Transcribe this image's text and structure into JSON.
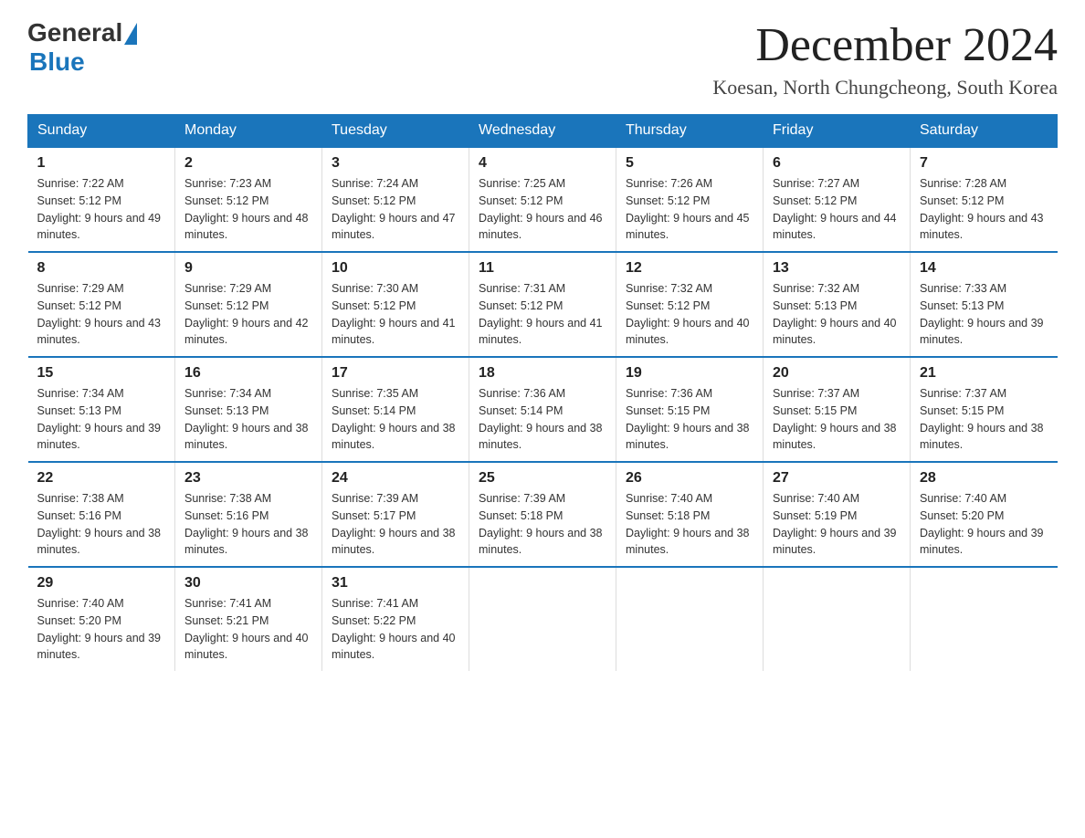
{
  "logo": {
    "general": "General",
    "blue": "Blue"
  },
  "title": "December 2024",
  "subtitle": "Koesan, North Chungcheong, South Korea",
  "days_of_week": [
    "Sunday",
    "Monday",
    "Tuesday",
    "Wednesday",
    "Thursday",
    "Friday",
    "Saturday"
  ],
  "weeks": [
    [
      {
        "day": "1",
        "sunrise": "7:22 AM",
        "sunset": "5:12 PM",
        "daylight": "9 hours and 49 minutes."
      },
      {
        "day": "2",
        "sunrise": "7:23 AM",
        "sunset": "5:12 PM",
        "daylight": "9 hours and 48 minutes."
      },
      {
        "day": "3",
        "sunrise": "7:24 AM",
        "sunset": "5:12 PM",
        "daylight": "9 hours and 47 minutes."
      },
      {
        "day": "4",
        "sunrise": "7:25 AM",
        "sunset": "5:12 PM",
        "daylight": "9 hours and 46 minutes."
      },
      {
        "day": "5",
        "sunrise": "7:26 AM",
        "sunset": "5:12 PM",
        "daylight": "9 hours and 45 minutes."
      },
      {
        "day": "6",
        "sunrise": "7:27 AM",
        "sunset": "5:12 PM",
        "daylight": "9 hours and 44 minutes."
      },
      {
        "day": "7",
        "sunrise": "7:28 AM",
        "sunset": "5:12 PM",
        "daylight": "9 hours and 43 minutes."
      }
    ],
    [
      {
        "day": "8",
        "sunrise": "7:29 AM",
        "sunset": "5:12 PM",
        "daylight": "9 hours and 43 minutes."
      },
      {
        "day": "9",
        "sunrise": "7:29 AM",
        "sunset": "5:12 PM",
        "daylight": "9 hours and 42 minutes."
      },
      {
        "day": "10",
        "sunrise": "7:30 AM",
        "sunset": "5:12 PM",
        "daylight": "9 hours and 41 minutes."
      },
      {
        "day": "11",
        "sunrise": "7:31 AM",
        "sunset": "5:12 PM",
        "daylight": "9 hours and 41 minutes."
      },
      {
        "day": "12",
        "sunrise": "7:32 AM",
        "sunset": "5:12 PM",
        "daylight": "9 hours and 40 minutes."
      },
      {
        "day": "13",
        "sunrise": "7:32 AM",
        "sunset": "5:13 PM",
        "daylight": "9 hours and 40 minutes."
      },
      {
        "day": "14",
        "sunrise": "7:33 AM",
        "sunset": "5:13 PM",
        "daylight": "9 hours and 39 minutes."
      }
    ],
    [
      {
        "day": "15",
        "sunrise": "7:34 AM",
        "sunset": "5:13 PM",
        "daylight": "9 hours and 39 minutes."
      },
      {
        "day": "16",
        "sunrise": "7:34 AM",
        "sunset": "5:13 PM",
        "daylight": "9 hours and 38 minutes."
      },
      {
        "day": "17",
        "sunrise": "7:35 AM",
        "sunset": "5:14 PM",
        "daylight": "9 hours and 38 minutes."
      },
      {
        "day": "18",
        "sunrise": "7:36 AM",
        "sunset": "5:14 PM",
        "daylight": "9 hours and 38 minutes."
      },
      {
        "day": "19",
        "sunrise": "7:36 AM",
        "sunset": "5:15 PM",
        "daylight": "9 hours and 38 minutes."
      },
      {
        "day": "20",
        "sunrise": "7:37 AM",
        "sunset": "5:15 PM",
        "daylight": "9 hours and 38 minutes."
      },
      {
        "day": "21",
        "sunrise": "7:37 AM",
        "sunset": "5:15 PM",
        "daylight": "9 hours and 38 minutes."
      }
    ],
    [
      {
        "day": "22",
        "sunrise": "7:38 AM",
        "sunset": "5:16 PM",
        "daylight": "9 hours and 38 minutes."
      },
      {
        "day": "23",
        "sunrise": "7:38 AM",
        "sunset": "5:16 PM",
        "daylight": "9 hours and 38 minutes."
      },
      {
        "day": "24",
        "sunrise": "7:39 AM",
        "sunset": "5:17 PM",
        "daylight": "9 hours and 38 minutes."
      },
      {
        "day": "25",
        "sunrise": "7:39 AM",
        "sunset": "5:18 PM",
        "daylight": "9 hours and 38 minutes."
      },
      {
        "day": "26",
        "sunrise": "7:40 AM",
        "sunset": "5:18 PM",
        "daylight": "9 hours and 38 minutes."
      },
      {
        "day": "27",
        "sunrise": "7:40 AM",
        "sunset": "5:19 PM",
        "daylight": "9 hours and 39 minutes."
      },
      {
        "day": "28",
        "sunrise": "7:40 AM",
        "sunset": "5:20 PM",
        "daylight": "9 hours and 39 minutes."
      }
    ],
    [
      {
        "day": "29",
        "sunrise": "7:40 AM",
        "sunset": "5:20 PM",
        "daylight": "9 hours and 39 minutes."
      },
      {
        "day": "30",
        "sunrise": "7:41 AM",
        "sunset": "5:21 PM",
        "daylight": "9 hours and 40 minutes."
      },
      {
        "day": "31",
        "sunrise": "7:41 AM",
        "sunset": "5:22 PM",
        "daylight": "9 hours and 40 minutes."
      },
      null,
      null,
      null,
      null
    ]
  ]
}
